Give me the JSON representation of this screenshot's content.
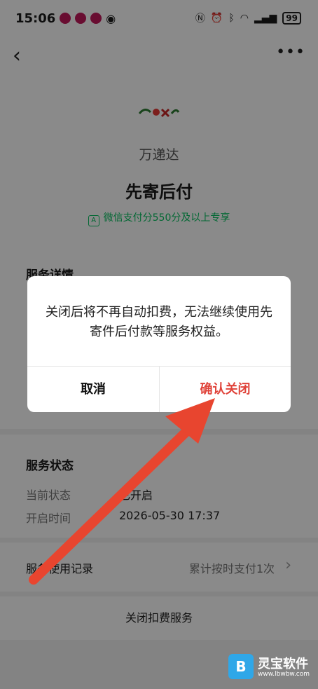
{
  "status_bar": {
    "time": "15:06",
    "battery": "99"
  },
  "hero": {
    "logo_text": "万递达",
    "brand": "万递达",
    "title": "先寄后付",
    "score_note": "微信支付分550分及以上专享"
  },
  "details": {
    "title": "服务详情"
  },
  "service_status": {
    "title": "服务状态",
    "rows": [
      {
        "label": "当前状态",
        "value": "已开启"
      },
      {
        "label": "开启时间",
        "value": "2026-05-30 17:37"
      }
    ]
  },
  "usage": {
    "label": "服务使用记录",
    "value": "累计按时支付1次"
  },
  "close_service": {
    "label": "关闭扣费服务"
  },
  "dialog": {
    "message": "关闭后将不再自动扣费，无法继续使用先寄件后付款等服务权益。",
    "cancel": "取消",
    "confirm": "确认关闭"
  },
  "watermark": {
    "name": "灵宝软件",
    "url": "www.lbwbw.com"
  },
  "colors": {
    "accent_green": "#07c160",
    "confirm_red": "#e0433a",
    "arrow_red": "#e8452f"
  }
}
